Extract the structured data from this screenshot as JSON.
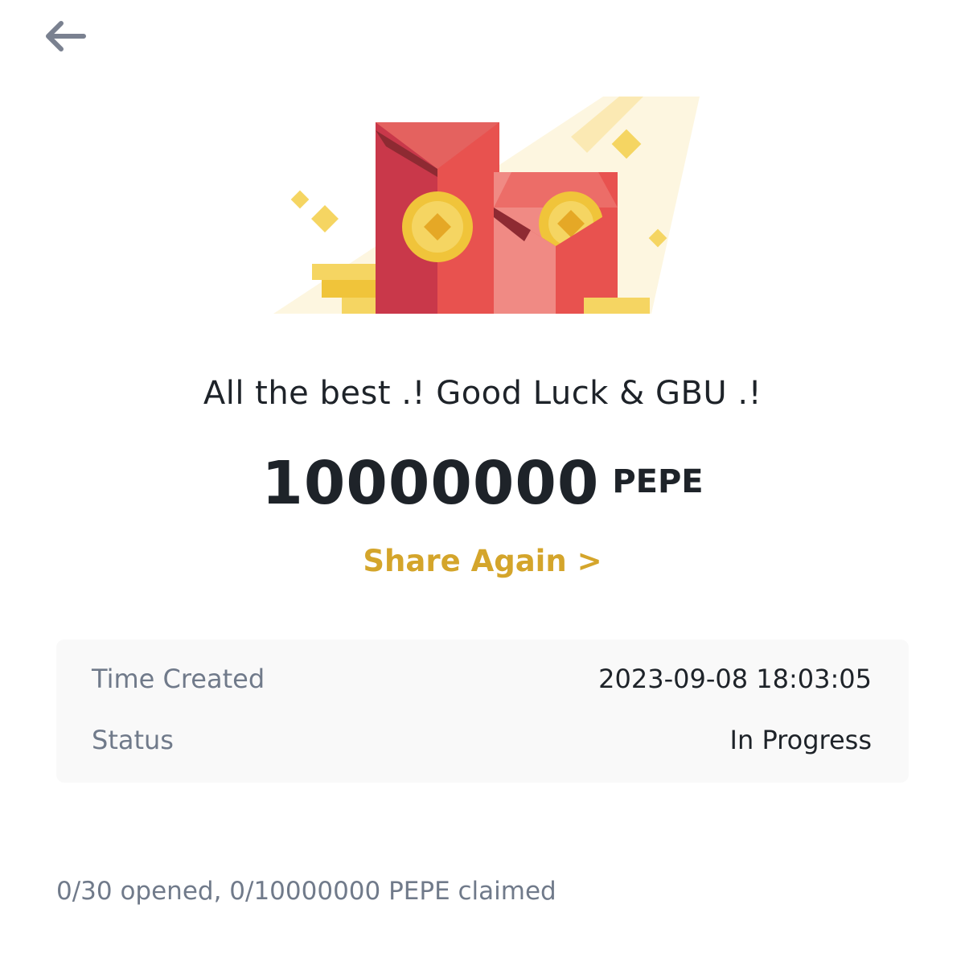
{
  "header": {
    "back_icon": "arrow-left-icon"
  },
  "illustration": {
    "name": "red-envelopes-with-coins",
    "colors": {
      "envelope_dark": "#c9384a",
      "envelope_light": "#e8524f",
      "coin": "#f0c43a",
      "sparkle": "#f5d562"
    }
  },
  "greeting": "All the best .! Good Luck & GBU .!",
  "amount": {
    "value": "10000000",
    "unit": "PEPE"
  },
  "share_again": {
    "label": "Share Again >",
    "color": "#d4a52b"
  },
  "details": {
    "time_created": {
      "label": "Time Created",
      "value": "2023-09-08 18:03:05"
    },
    "status": {
      "label": "Status",
      "value": "In Progress"
    }
  },
  "footer": {
    "summary": "0/30 opened, 0/10000000 PEPE claimed"
  }
}
